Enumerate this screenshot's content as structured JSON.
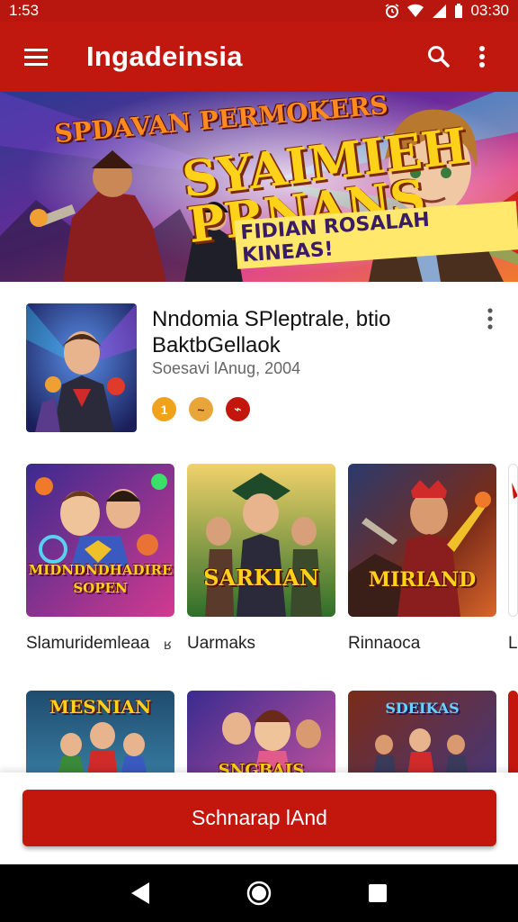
{
  "status_bar": {
    "time_left": "1:53",
    "time_right": "03:30",
    "icons": [
      "alarm-icon",
      "wifi-icon",
      "signal-icon",
      "battery-icon"
    ]
  },
  "app_bar": {
    "title": "Ingadeinsia",
    "icons": [
      "menu-icon",
      "search-icon",
      "more-vert-icon"
    ]
  },
  "banner": {
    "title_small": "SPDAVAN PERMOKERS",
    "title_large": "SYAIMIEH PRNANS",
    "subtitle": "FIDIAN ROSALAH KINEAS!"
  },
  "featured": {
    "title": "Nndomia SPleptrale, btio BaktbGellaok",
    "date": "Soesavi lAnug, 2004",
    "badges": [
      {
        "icon": "coin-icon",
        "glyph": "1",
        "color": "#f0a21a"
      },
      {
        "icon": "mustache-icon",
        "glyph": "~",
        "color": "#e8a63a"
      },
      {
        "icon": "fire-icon",
        "glyph": "⌁",
        "color": "#c3170e"
      }
    ]
  },
  "games_row_1": [
    {
      "label": "Slamuridemleaa",
      "caption": "MIDNDNDHADIRE SOPEN",
      "palette": [
        "#3b2a8f",
        "#d23a8f"
      ]
    },
    {
      "label": "Uarmaks",
      "caption": "SARKIAN",
      "palette": [
        "#2f6e2a",
        "#8fc24a"
      ]
    },
    {
      "label": "Rinnaoca",
      "caption": "MIRIAND",
      "palette": [
        "#5a1f18",
        "#d8662a"
      ]
    },
    {
      "label": "L",
      "caption": "",
      "palette": [
        "#ffffff",
        "#ffffff"
      ]
    }
  ],
  "games_row_1_extra_glyph": "ʁ",
  "games_row_2": [
    {
      "caption": "MESNIAN",
      "palette": [
        "#1f4c6e",
        "#4aa0c8"
      ]
    },
    {
      "caption": "SNGBAIS",
      "palette": [
        "#3a2b8f",
        "#e05aa0"
      ]
    },
    {
      "caption": "SDEIKAS",
      "palette": [
        "#7a2b18",
        "#3a3a8f"
      ]
    },
    {
      "caption": "",
      "palette": [
        "#c3170e",
        "#8f0f0a"
      ]
    }
  ],
  "cta": {
    "label": "Schnarap lAnd"
  },
  "nav_bar": {
    "icons": [
      "back-icon",
      "home-icon",
      "recents-icon"
    ]
  },
  "colors": {
    "primary": "#c0170f",
    "status_bar": "#b7170f",
    "cta": "#c3170e"
  }
}
